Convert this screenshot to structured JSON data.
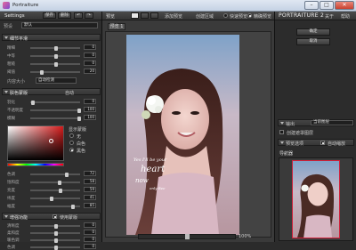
{
  "window": {
    "title": "Portraiture",
    "minimize": "–",
    "maximize": "□",
    "close": "✕"
  },
  "left": {
    "settings_label": "Settings",
    "save": "保存",
    "delete": "删除",
    "undo": "↶",
    "redo": "↷",
    "preset_label": "预设",
    "preset_value": "默认",
    "detail": {
      "title": "细节平滑",
      "rows": [
        {
          "label": "精细",
          "value": "0"
        },
        {
          "label": "中等",
          "value": "0"
        },
        {
          "label": "粗糙",
          "value": "0"
        },
        {
          "label": "阈值",
          "value": "20"
        }
      ],
      "fx_label": "内容大小",
      "fx_value": "自动检测"
    },
    "mask": {
      "title": "肤色蒙版",
      "auto": "自动",
      "rows": [
        {
          "label": "羽化",
          "value": "0"
        },
        {
          "label": "不透明度",
          "value": "100"
        },
        {
          "label": "模糊",
          "value": "100"
        }
      ],
      "opts_title": "显示蒙版",
      "opts": [
        "无",
        "白色",
        "黑色"
      ],
      "hsv": [
        {
          "label": "色调",
          "value": "72"
        },
        {
          "label": "饱和度",
          "value": "58"
        },
        {
          "label": "亮度",
          "value": "59"
        },
        {
          "label": "纬度",
          "value": "41"
        },
        {
          "label": "幅度",
          "value": "85"
        }
      ]
    },
    "enhance": {
      "title": "增强功能",
      "use_mask": "使用蒙版",
      "rows": [
        {
          "label": "清晰度",
          "value": "0"
        },
        {
          "label": "柔和度",
          "value": "0"
        },
        {
          "label": "暖色调",
          "value": "0"
        },
        {
          "label": "色调",
          "value": "0"
        }
      ]
    }
  },
  "mid": {
    "preview": "预览",
    "add_preview": "添加预览",
    "region": "创建区域",
    "quick_preview": "快速预览",
    "fine_preview": "精确预览",
    "tab": "预览 1",
    "zoom": "100%"
  },
  "right": {
    "brand": "PORTRAITURE 2",
    "about": "关于",
    "help": "帮助",
    "ok": "确定",
    "cancel": "取消",
    "output_label": "输出",
    "output_value": "当前图层",
    "create_mask": "创建遮罩图层",
    "preview_opts": "预览选项",
    "auto_zoom": "自动缩放",
    "navigator": "导航器"
  },
  "art": {
    "script_line1": "Yes I'll be your",
    "script_line2": "heart",
    "script_line3": "now",
    "script_line4": "only Bee"
  }
}
